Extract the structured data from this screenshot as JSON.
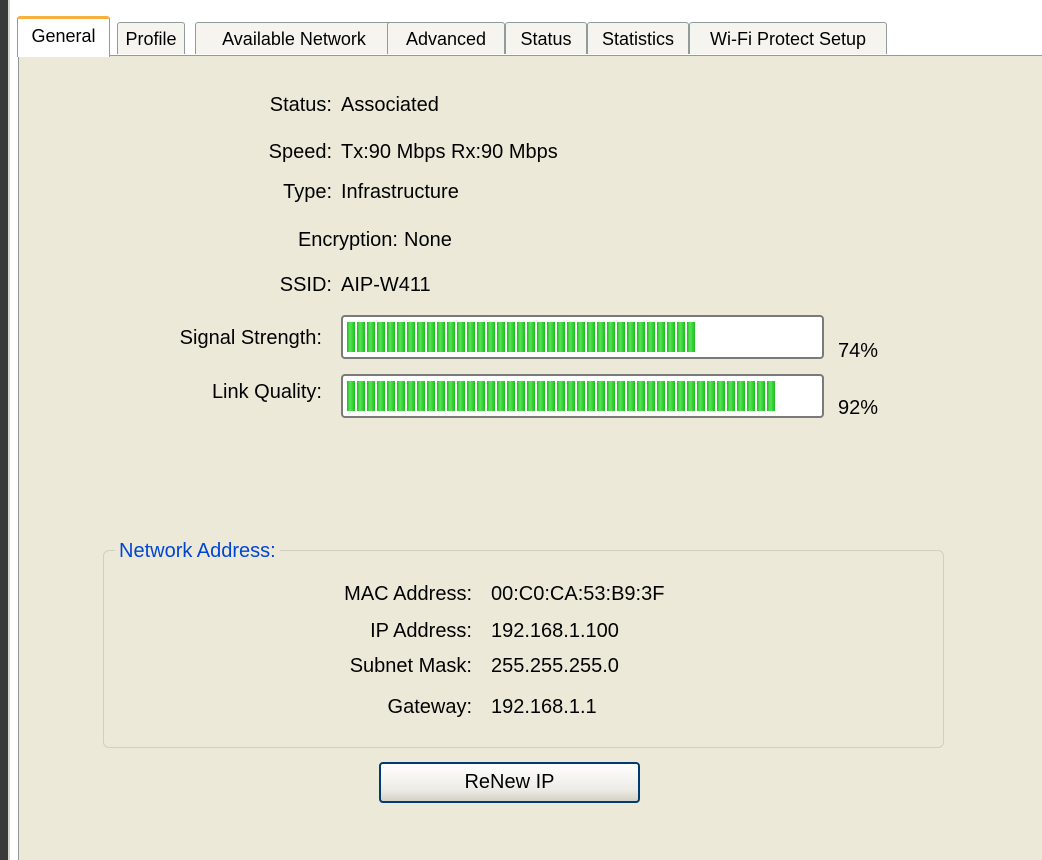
{
  "tabs": [
    {
      "label": "General",
      "active": true
    },
    {
      "label": "Profile",
      "active": false
    },
    {
      "label": "Available Network",
      "active": false
    },
    {
      "label": "Advanced",
      "active": false
    },
    {
      "label": "Status",
      "active": false
    },
    {
      "label": "Statistics",
      "active": false
    },
    {
      "label": "Wi-Fi Protect Setup",
      "active": false
    }
  ],
  "general": {
    "status": {
      "label": "Status:",
      "value": "Associated"
    },
    "speed": {
      "label": "Speed:",
      "value": "Tx:90 Mbps Rx:90 Mbps"
    },
    "type": {
      "label": "Type:",
      "value": "Infrastructure"
    },
    "encryption": {
      "label": "Encryption:",
      "value": "None"
    },
    "ssid": {
      "label": "SSID:",
      "value": "AIP-W411"
    },
    "signal_strength": {
      "label": "Signal Strength:",
      "percent_text": "74%",
      "level": 0.74
    },
    "link_quality": {
      "label": "Link Quality:",
      "percent_text": "92%",
      "level": 0.92
    }
  },
  "network_address": {
    "title": "Network Address:",
    "mac": {
      "label": "MAC Address:",
      "value": "00:C0:CA:53:B9:3F"
    },
    "ip": {
      "label": "IP Address:",
      "value": "192.168.1.100"
    },
    "subnet": {
      "label": "Subnet Mask:",
      "value": "255.255.255.0"
    },
    "gateway": {
      "label": "Gateway:",
      "value": "192.168.1.1"
    }
  },
  "buttons": {
    "renew_ip": "ReNew IP"
  },
  "colors": {
    "panel_bg": "#ece9d8",
    "bar_green": "#18c018",
    "group_title": "#0046d5",
    "active_tab_accent": "#f8b03e"
  }
}
